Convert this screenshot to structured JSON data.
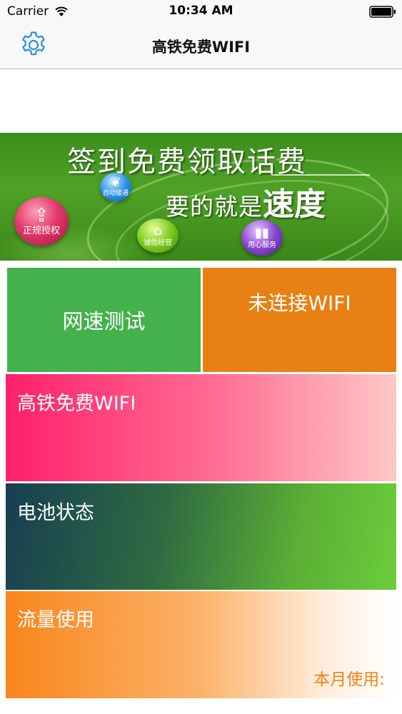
{
  "status_bar": {
    "carrier": "Carrier",
    "time": "10:34 AM",
    "wifi_icon": "wifi-signal-icon",
    "battery_icon": "battery-full-icon"
  },
  "nav": {
    "title": "高铁免费WIFI",
    "settings_icon": "gear-icon",
    "accent_color": "#2e8ddd"
  },
  "banner": {
    "line1": "签到免费领取话费",
    "line2_prefix": "要的就是",
    "line2_emphasis": "速度",
    "badges": [
      {
        "icon": "shield-upload-icon",
        "label": "正规授权"
      },
      {
        "icon": "leaf-icon",
        "label": "自动接通"
      },
      {
        "icon": "shop-icon",
        "label": "诚信经营"
      },
      {
        "icon": "bar-chart-icon",
        "label": "用心服务"
      }
    ]
  },
  "tiles": {
    "speed_test": {
      "label": "网速测试",
      "color": "#45b14c"
    },
    "wifi_status": {
      "label": "未连接WIFI",
      "color": "#e88013"
    },
    "free_wifi": {
      "label": "高铁免费WIFI",
      "color": "#ff1f6a"
    },
    "battery": {
      "label": "电池状态",
      "color": "#2f6a42"
    },
    "traffic": {
      "label": "流量使用",
      "month_usage_label": "本月使用:",
      "color": "#f9861b"
    }
  }
}
